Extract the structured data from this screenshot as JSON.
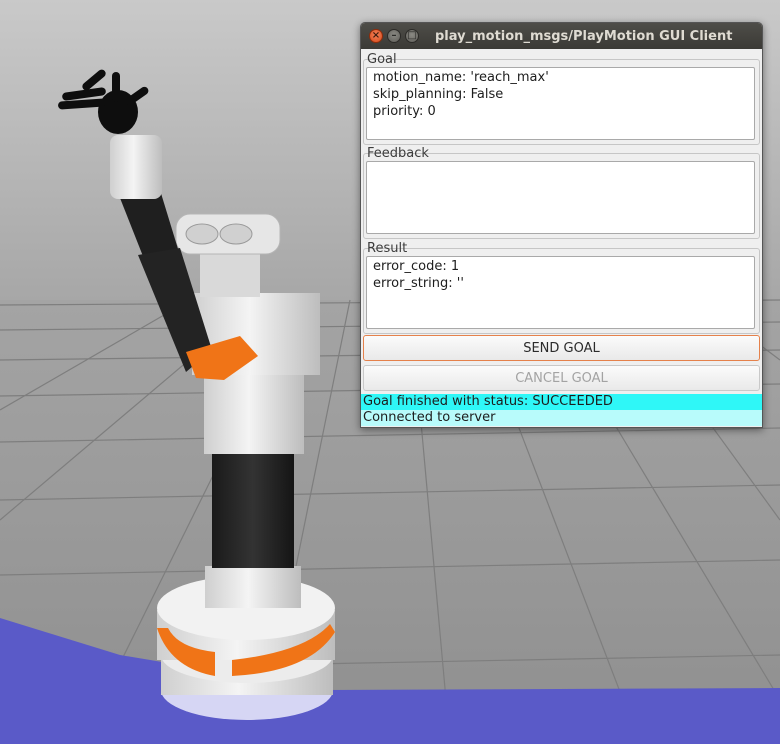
{
  "window": {
    "title": "play_motion_msgs/PlayMotion GUI Client",
    "controls": {
      "close": "×",
      "minimize": "–",
      "maximize": "□"
    }
  },
  "goal": {
    "label": "Goal",
    "lines": [
      "motion_name: 'reach_max'",
      "skip_planning: False",
      "priority: 0"
    ]
  },
  "feedback": {
    "label": "Feedback",
    "lines": []
  },
  "result": {
    "label": "Result",
    "lines": [
      "error_code: 1",
      "error_string: ''"
    ]
  },
  "buttons": {
    "send_goal": "SEND GOAL",
    "cancel_goal": "CANCEL GOAL"
  },
  "status": {
    "goal_status": "Goal finished with status: SUCCEEDED",
    "connection": "Connected to server",
    "goal_status_color": "#2ff7f7",
    "connection_color": "#b8fbfb"
  },
  "scene": {
    "accent_color": "#f07417",
    "ground_color": "#5a5ac8",
    "grid_background": "#9a9a9a"
  }
}
